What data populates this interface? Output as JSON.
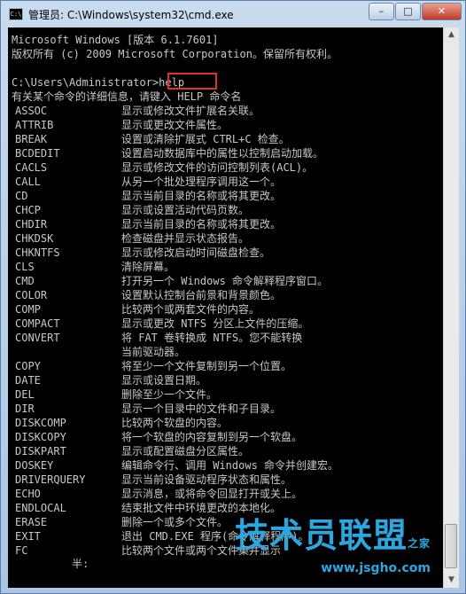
{
  "window": {
    "title": "管理员: C:\\Windows\\system32\\cmd.exe",
    "icon_text": "C:\\",
    "buttons": {
      "minimize": "–",
      "maximize": "□",
      "close": "✕"
    }
  },
  "console": {
    "header": [
      "Microsoft Windows [版本 6.1.7601]",
      "版权所有 (c) 2009 Microsoft Corporation。保留所有权利。"
    ],
    "prompt_path": "C:\\Users\\Administrator",
    "prompt_command": ">help",
    "help_intro": "有关某个命令的详细信息，请键入 HELP 命令名",
    "commands": [
      {
        "name": "ASSOC",
        "desc": "显示或修改文件扩展名关联。"
      },
      {
        "name": "ATTRIB",
        "desc": "显示或更改文件属性。"
      },
      {
        "name": "BREAK",
        "desc": "设置或清除扩展式 CTRL+C 检查。"
      },
      {
        "name": "BCDEDIT",
        "desc": "设置启动数据库中的属性以控制启动加载。"
      },
      {
        "name": "CACLS",
        "desc": "显示或修改文件的访问控制列表(ACL)。"
      },
      {
        "name": "CALL",
        "desc": "从另一个批处理程序调用这一个。"
      },
      {
        "name": "CD",
        "desc": "显示当前目录的名称或将其更改。"
      },
      {
        "name": "CHCP",
        "desc": "显示或设置活动代码页数。"
      },
      {
        "name": "CHDIR",
        "desc": "显示当前目录的名称或将其更改。"
      },
      {
        "name": "CHKDSK",
        "desc": "检查磁盘并显示状态报告。"
      },
      {
        "name": "CHKNTFS",
        "desc": "显示或修改启动时间磁盘检查。"
      },
      {
        "name": "CLS",
        "desc": "清除屏幕。"
      },
      {
        "name": "CMD",
        "desc": "打开另一个 Windows 命令解释程序窗口。"
      },
      {
        "name": "COLOR",
        "desc": "设置默认控制台前景和背景颜色。"
      },
      {
        "name": "COMP",
        "desc": "比较两个或两套文件的内容。"
      },
      {
        "name": "COMPACT",
        "desc": "显示或更改 NTFS 分区上文件的压缩。"
      },
      {
        "name": "CONVERT",
        "desc": "将 FAT 卷转换成 NTFS。您不能转换"
      },
      {
        "name": "",
        "desc": "当前驱动器。"
      },
      {
        "name": "COPY",
        "desc": "将至少一个文件复制到另一个位置。"
      },
      {
        "name": "DATE",
        "desc": "显示或设置日期。"
      },
      {
        "name": "DEL",
        "desc": "删除至少一个文件。"
      },
      {
        "name": "DIR",
        "desc": "显示一个目录中的文件和子目录。"
      },
      {
        "name": "DISKCOMP",
        "desc": "比较两个软盘的内容。"
      },
      {
        "name": "DISKCOPY",
        "desc": "将一个软盘的内容复制到另一个软盘。"
      },
      {
        "name": "DISKPART",
        "desc": "显示或配置磁盘分区属性。"
      },
      {
        "name": "DOSKEY",
        "desc": "编辑命令行、调用 Windows 命令并创建宏。"
      },
      {
        "name": "DRIVERQUERY",
        "desc": "显示当前设备驱动程序状态和属性。"
      },
      {
        "name": "ECHO",
        "desc": "显示消息，或将命令回显打开或关上。"
      },
      {
        "name": "ENDLOCAL",
        "desc": "结束批文件中环境更改的本地化。"
      },
      {
        "name": "ERASE",
        "desc": "删除一个或多个文件。"
      },
      {
        "name": "EXIT",
        "desc": "退出 CMD.EXE 程序(命令解释程序)。"
      },
      {
        "name": "FC",
        "desc": "比较两个文件或两个文件集并显示"
      }
    ],
    "ime_status": "半:"
  },
  "watermark": {
    "brand": "技术员联盟",
    "suffix": "之家",
    "url": "www.jsgho.com"
  },
  "colors": {
    "console_bg": "#000000",
    "console_text": "#c8c8c8",
    "highlight_box": "#e0302a",
    "watermark": "#2aa7e0"
  }
}
